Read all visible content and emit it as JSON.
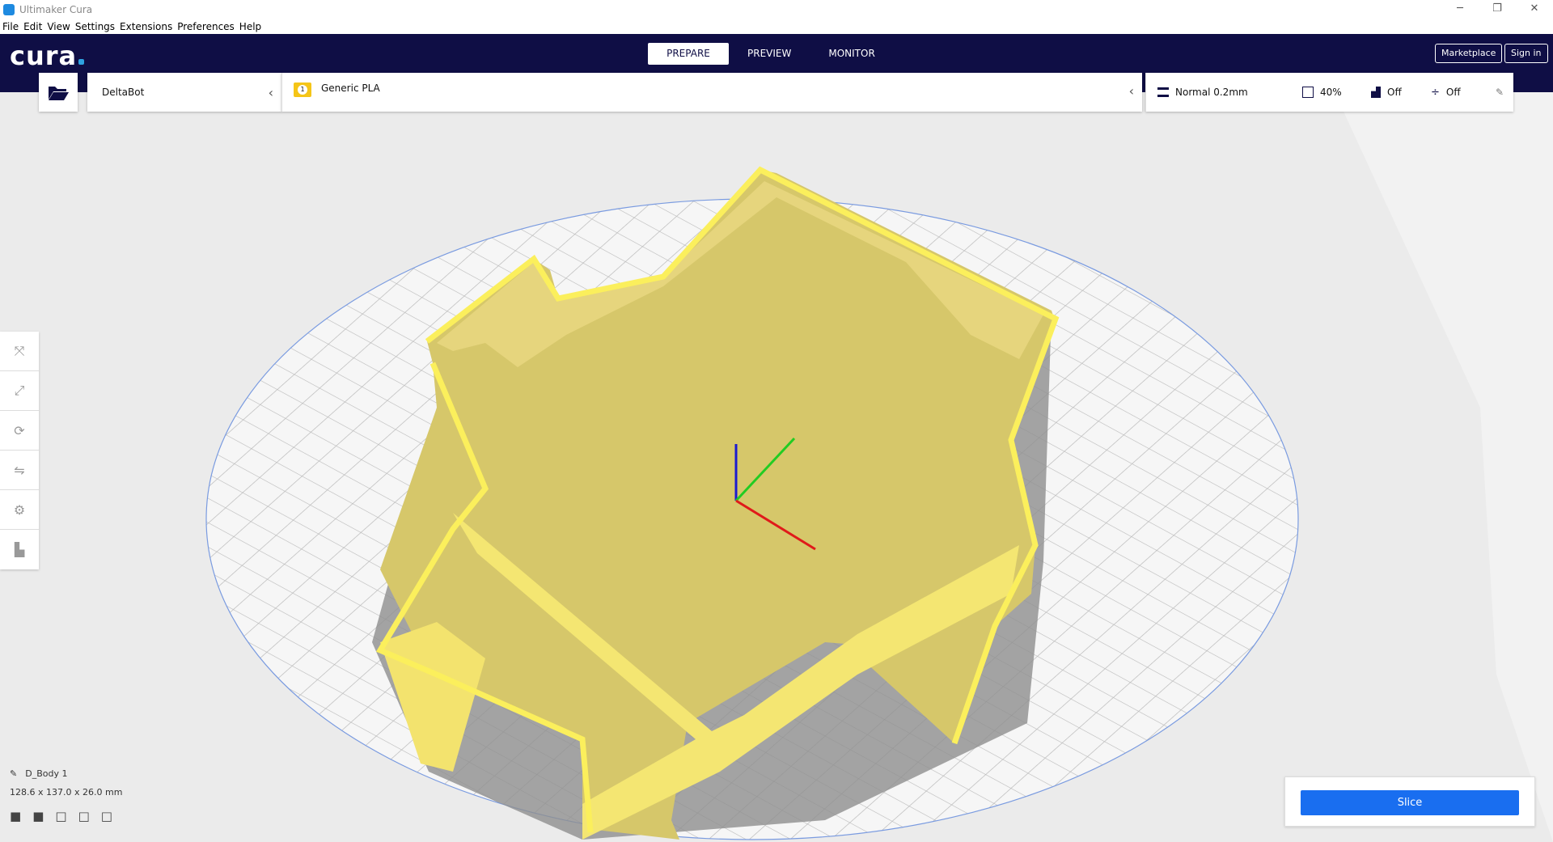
{
  "window": {
    "title": "Ultimaker Cura",
    "minimize": "─",
    "restore": "❐",
    "close": "✕"
  },
  "menu": [
    "File",
    "Edit",
    "View",
    "Settings",
    "Extensions",
    "Preferences",
    "Help"
  ],
  "header": {
    "brand": "cura",
    "tabs": [
      "PREPARE",
      "PREVIEW",
      "MONITOR"
    ],
    "active_tab": "PREPARE",
    "marketplace": "Marketplace",
    "sign_in": "Sign in"
  },
  "toolbar": {
    "printer": "DeltaBot",
    "extruder_number": "1",
    "material": "Generic PLA",
    "profile": "Normal 0.2mm",
    "infill": "40%",
    "support": "Off",
    "adhesion": "Off"
  },
  "object": {
    "name": "D_Body 1",
    "dimensions": "128.6 x 137.0 x 26.0 mm"
  },
  "slice": {
    "label": "Slice"
  },
  "colors": {
    "header": "#0f0e45",
    "accent": "#196ef0",
    "model": "#f0e07a"
  }
}
